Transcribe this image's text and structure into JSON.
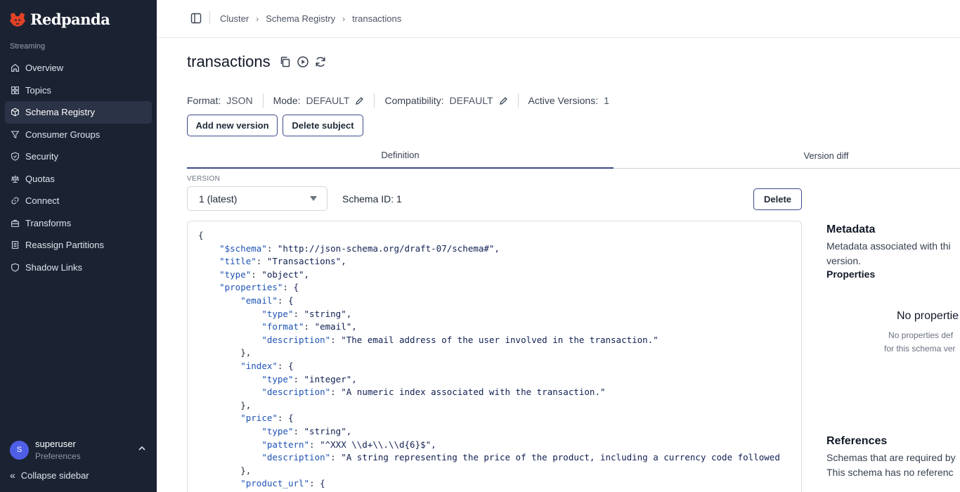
{
  "app": {
    "brand": "Redpanda",
    "brand_color": "#e14226"
  },
  "sidebar": {
    "section": "Streaming",
    "items": [
      {
        "label": "Overview",
        "icon": "home-icon",
        "active": false
      },
      {
        "label": "Topics",
        "icon": "grid-icon",
        "active": false
      },
      {
        "label": "Schema Registry",
        "icon": "cube-icon",
        "active": true
      },
      {
        "label": "Consumer Groups",
        "icon": "filter-icon",
        "active": false
      },
      {
        "label": "Security",
        "icon": "shield-icon",
        "active": false
      },
      {
        "label": "Quotas",
        "icon": "scale-icon",
        "active": false
      },
      {
        "label": "Connect",
        "icon": "link-icon",
        "active": false
      },
      {
        "label": "Transforms",
        "icon": "briefcase-icon",
        "active": false
      },
      {
        "label": "Reassign Partitions",
        "icon": "list-icon",
        "active": false
      },
      {
        "label": "Shadow Links",
        "icon": "shield-outline-icon",
        "active": false
      }
    ],
    "user": {
      "initial": "S",
      "name": "superuser",
      "sub": "Preferences"
    },
    "collapse_label": "Collapse sidebar"
  },
  "breadcrumb": [
    "Cluster",
    "Schema Registry",
    "transactions"
  ],
  "page": {
    "title": "transactions",
    "format_label": "Format:",
    "format_value": "JSON",
    "mode_label": "Mode:",
    "mode_value": "DEFAULT",
    "compat_label": "Compatibility:",
    "compat_value": "DEFAULT",
    "active_label": "Active Versions:",
    "active_value": "1",
    "add_version": "Add new version",
    "delete_subject": "Delete subject"
  },
  "tabs": {
    "definition": "Definition",
    "version_diff": "Version diff"
  },
  "version": {
    "label": "VERSION",
    "selected": "1 (latest)",
    "schema_id": "Schema ID: 1",
    "delete": "Delete"
  },
  "code_lines": [
    "{",
    "    \"$schema\": \"http://json-schema.org/draft-07/schema#\",",
    "    \"title\": \"Transactions\",",
    "    \"type\": \"object\",",
    "    \"properties\": {",
    "        \"email\": {",
    "            \"type\": \"string\",",
    "            \"format\": \"email\",",
    "            \"description\": \"The email address of the user involved in the transaction.\"",
    "        },",
    "        \"index\": {",
    "            \"type\": \"integer\",",
    "            \"description\": \"A numeric index associated with the transaction.\"",
    "        },",
    "        \"price\": {",
    "            \"type\": \"string\",",
    "            \"pattern\": \"^XXX \\\\d+\\\\.\\\\d{6}$\",",
    "            \"description\": \"A string representing the price of the product, including a currency code followed",
    "        },",
    "        \"product_url\": {"
  ],
  "right_panel": {
    "metadata_title": "Metadata",
    "metadata_desc": "Metadata associated with thi",
    "metadata_desc2": "version.",
    "properties_title": "Properties",
    "no_props_title": "No propertie",
    "no_props_desc1": "No properties def",
    "no_props_desc2": "for this schema ver",
    "references_title": "References",
    "references_desc1": "Schemas that are required by",
    "references_desc2": "This schema has no referenc"
  }
}
